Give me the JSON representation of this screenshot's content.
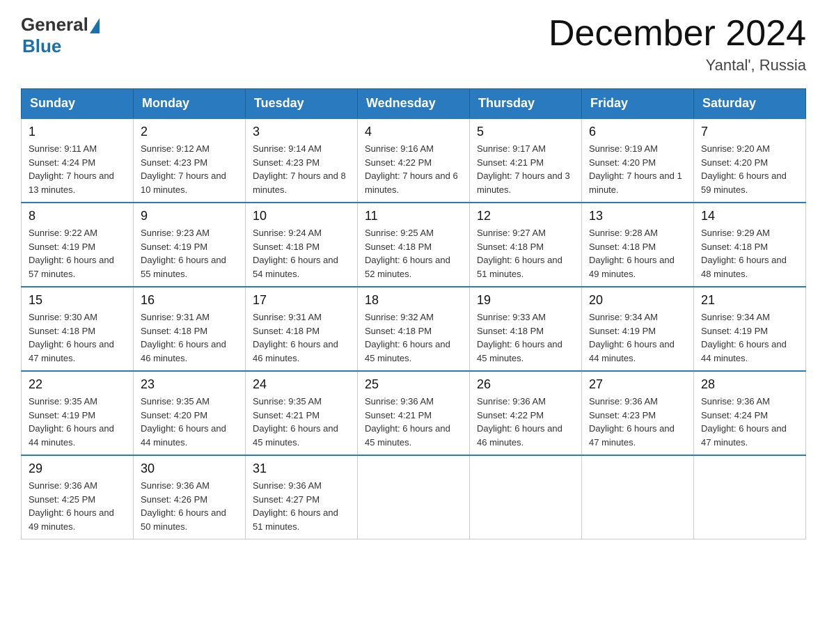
{
  "header": {
    "logo_general": "General",
    "logo_blue": "Blue",
    "month_title": "December 2024",
    "location": "Yantal', Russia"
  },
  "weekdays": [
    "Sunday",
    "Monday",
    "Tuesday",
    "Wednesday",
    "Thursday",
    "Friday",
    "Saturday"
  ],
  "weeks": [
    [
      {
        "day": "1",
        "sunrise": "Sunrise: 9:11 AM",
        "sunset": "Sunset: 4:24 PM",
        "daylight": "Daylight: 7 hours and 13 minutes."
      },
      {
        "day": "2",
        "sunrise": "Sunrise: 9:12 AM",
        "sunset": "Sunset: 4:23 PM",
        "daylight": "Daylight: 7 hours and 10 minutes."
      },
      {
        "day": "3",
        "sunrise": "Sunrise: 9:14 AM",
        "sunset": "Sunset: 4:23 PM",
        "daylight": "Daylight: 7 hours and 8 minutes."
      },
      {
        "day": "4",
        "sunrise": "Sunrise: 9:16 AM",
        "sunset": "Sunset: 4:22 PM",
        "daylight": "Daylight: 7 hours and 6 minutes."
      },
      {
        "day": "5",
        "sunrise": "Sunrise: 9:17 AM",
        "sunset": "Sunset: 4:21 PM",
        "daylight": "Daylight: 7 hours and 3 minutes."
      },
      {
        "day": "6",
        "sunrise": "Sunrise: 9:19 AM",
        "sunset": "Sunset: 4:20 PM",
        "daylight": "Daylight: 7 hours and 1 minute."
      },
      {
        "day": "7",
        "sunrise": "Sunrise: 9:20 AM",
        "sunset": "Sunset: 4:20 PM",
        "daylight": "Daylight: 6 hours and 59 minutes."
      }
    ],
    [
      {
        "day": "8",
        "sunrise": "Sunrise: 9:22 AM",
        "sunset": "Sunset: 4:19 PM",
        "daylight": "Daylight: 6 hours and 57 minutes."
      },
      {
        "day": "9",
        "sunrise": "Sunrise: 9:23 AM",
        "sunset": "Sunset: 4:19 PM",
        "daylight": "Daylight: 6 hours and 55 minutes."
      },
      {
        "day": "10",
        "sunrise": "Sunrise: 9:24 AM",
        "sunset": "Sunset: 4:18 PM",
        "daylight": "Daylight: 6 hours and 54 minutes."
      },
      {
        "day": "11",
        "sunrise": "Sunrise: 9:25 AM",
        "sunset": "Sunset: 4:18 PM",
        "daylight": "Daylight: 6 hours and 52 minutes."
      },
      {
        "day": "12",
        "sunrise": "Sunrise: 9:27 AM",
        "sunset": "Sunset: 4:18 PM",
        "daylight": "Daylight: 6 hours and 51 minutes."
      },
      {
        "day": "13",
        "sunrise": "Sunrise: 9:28 AM",
        "sunset": "Sunset: 4:18 PM",
        "daylight": "Daylight: 6 hours and 49 minutes."
      },
      {
        "day": "14",
        "sunrise": "Sunrise: 9:29 AM",
        "sunset": "Sunset: 4:18 PM",
        "daylight": "Daylight: 6 hours and 48 minutes."
      }
    ],
    [
      {
        "day": "15",
        "sunrise": "Sunrise: 9:30 AM",
        "sunset": "Sunset: 4:18 PM",
        "daylight": "Daylight: 6 hours and 47 minutes."
      },
      {
        "day": "16",
        "sunrise": "Sunrise: 9:31 AM",
        "sunset": "Sunset: 4:18 PM",
        "daylight": "Daylight: 6 hours and 46 minutes."
      },
      {
        "day": "17",
        "sunrise": "Sunrise: 9:31 AM",
        "sunset": "Sunset: 4:18 PM",
        "daylight": "Daylight: 6 hours and 46 minutes."
      },
      {
        "day": "18",
        "sunrise": "Sunrise: 9:32 AM",
        "sunset": "Sunset: 4:18 PM",
        "daylight": "Daylight: 6 hours and 45 minutes."
      },
      {
        "day": "19",
        "sunrise": "Sunrise: 9:33 AM",
        "sunset": "Sunset: 4:18 PM",
        "daylight": "Daylight: 6 hours and 45 minutes."
      },
      {
        "day": "20",
        "sunrise": "Sunrise: 9:34 AM",
        "sunset": "Sunset: 4:19 PM",
        "daylight": "Daylight: 6 hours and 44 minutes."
      },
      {
        "day": "21",
        "sunrise": "Sunrise: 9:34 AM",
        "sunset": "Sunset: 4:19 PM",
        "daylight": "Daylight: 6 hours and 44 minutes."
      }
    ],
    [
      {
        "day": "22",
        "sunrise": "Sunrise: 9:35 AM",
        "sunset": "Sunset: 4:19 PM",
        "daylight": "Daylight: 6 hours and 44 minutes."
      },
      {
        "day": "23",
        "sunrise": "Sunrise: 9:35 AM",
        "sunset": "Sunset: 4:20 PM",
        "daylight": "Daylight: 6 hours and 44 minutes."
      },
      {
        "day": "24",
        "sunrise": "Sunrise: 9:35 AM",
        "sunset": "Sunset: 4:21 PM",
        "daylight": "Daylight: 6 hours and 45 minutes."
      },
      {
        "day": "25",
        "sunrise": "Sunrise: 9:36 AM",
        "sunset": "Sunset: 4:21 PM",
        "daylight": "Daylight: 6 hours and 45 minutes."
      },
      {
        "day": "26",
        "sunrise": "Sunrise: 9:36 AM",
        "sunset": "Sunset: 4:22 PM",
        "daylight": "Daylight: 6 hours and 46 minutes."
      },
      {
        "day": "27",
        "sunrise": "Sunrise: 9:36 AM",
        "sunset": "Sunset: 4:23 PM",
        "daylight": "Daylight: 6 hours and 47 minutes."
      },
      {
        "day": "28",
        "sunrise": "Sunrise: 9:36 AM",
        "sunset": "Sunset: 4:24 PM",
        "daylight": "Daylight: 6 hours and 47 minutes."
      }
    ],
    [
      {
        "day": "29",
        "sunrise": "Sunrise: 9:36 AM",
        "sunset": "Sunset: 4:25 PM",
        "daylight": "Daylight: 6 hours and 49 minutes."
      },
      {
        "day": "30",
        "sunrise": "Sunrise: 9:36 AM",
        "sunset": "Sunset: 4:26 PM",
        "daylight": "Daylight: 6 hours and 50 minutes."
      },
      {
        "day": "31",
        "sunrise": "Sunrise: 9:36 AM",
        "sunset": "Sunset: 4:27 PM",
        "daylight": "Daylight: 6 hours and 51 minutes."
      },
      null,
      null,
      null,
      null
    ]
  ]
}
